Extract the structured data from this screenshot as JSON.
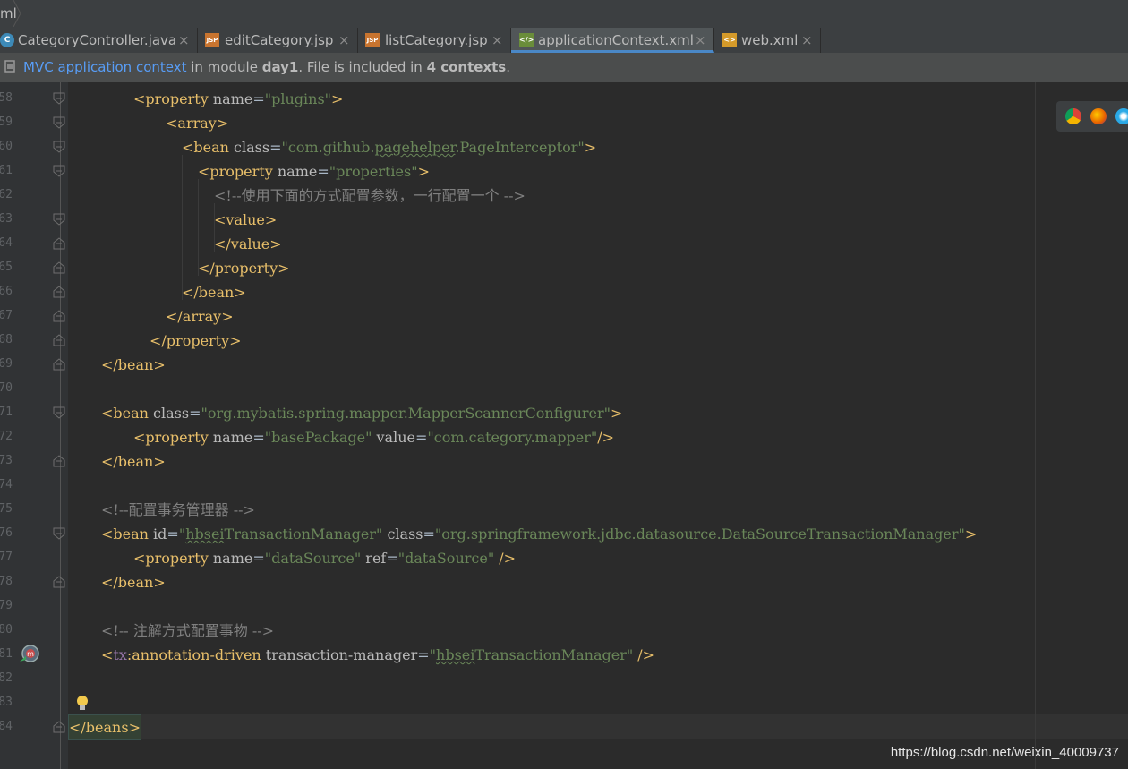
{
  "breadcrumb": {
    "label": "ml"
  },
  "tabs": [
    {
      "label": "CategoryController.java",
      "icon": "java-class-icon",
      "active": false
    },
    {
      "label": "editCategory.jsp",
      "icon": "jsp-file-icon",
      "active": false
    },
    {
      "label": "listCategory.jsp",
      "icon": "jsp-file-icon",
      "active": false
    },
    {
      "label": "applicationContext.xml",
      "icon": "spring-xml-icon",
      "active": true
    },
    {
      "label": "web.xml",
      "icon": "web-xml-icon",
      "active": false
    }
  ],
  "tab_close_glyph": "×",
  "banner": {
    "link": "MVC application context",
    "text_a": " in module ",
    "module": "day1",
    "text_b": ". File is included in ",
    "contexts": "4 contexts",
    "text_c": "."
  },
  "line_numbers": [
    "58",
    "59",
    "60",
    "61",
    "62",
    "63",
    "64",
    "65",
    "66",
    "67",
    "68",
    "69",
    "70",
    "71",
    "72",
    "73",
    "74",
    "75",
    "76",
    "77",
    "78",
    "79",
    "80",
    "81",
    "82",
    "83",
    "84"
  ],
  "code": {
    "l58": {
      "open": "<",
      "tag": "property",
      "attr": " name",
      "eq": "=",
      "val": "\"plugins\"",
      "close": ">"
    },
    "l59": {
      "text": "<array>"
    },
    "l60": {
      "open": "<",
      "tag": "bean",
      "attr": " class",
      "eq": "=",
      "val_a": "\"com.github.",
      "val_sq": "pagehelper",
      "val_b": ".PageInterceptor\"",
      "close": ">"
    },
    "l61": {
      "open": "<",
      "tag": "property",
      "attr": " name",
      "eq": "=",
      "val": "\"properties\"",
      "close": ">"
    },
    "l62": {
      "comment": "<!--使用下面的方式配置参数，一行配置一个 -->"
    },
    "l63": {
      "text": "<value>"
    },
    "l64": {
      "text": "</value>"
    },
    "l65": {
      "text": "</property>"
    },
    "l66": {
      "text": "</bean>"
    },
    "l67": {
      "text": "</array>"
    },
    "l68": {
      "text": "</property>"
    },
    "l69": {
      "text": "</bean>"
    },
    "l71": {
      "open": "<",
      "tag": "bean",
      "attr": " class",
      "eq": "=",
      "val": "\"org.mybatis.spring.mapper.MapperScannerConfigurer\"",
      "close": ">"
    },
    "l72": {
      "open": "<",
      "tag": "property",
      "attr1": " name",
      "val1": "\"basePackage\"",
      "attr2": " value",
      "val2": "\"com.category.mapper\"",
      "close": "/>",
      "eq": "="
    },
    "l73": {
      "text": "</bean>"
    },
    "l75": {
      "comment": "<!--配置事务管理器 -->"
    },
    "l76": {
      "open": "<",
      "tag": "bean",
      "attr1": " id",
      "val1_q": "\"",
      "val1_sq": "hbsei",
      "val1_b": "TransactionManager\"",
      "attr2": " class",
      "val2": "\"org.springframework.jdbc.datasource.DataSourceTransactionManager\"",
      "close": ">",
      "eq": "="
    },
    "l77": {
      "open": "<",
      "tag": "property",
      "attr1": " name",
      "val1": "\"dataSource\"",
      "attr2": " ref",
      "val2": "\"dataSource\"",
      "close": " />",
      "eq": "="
    },
    "l78": {
      "text": "</bean>"
    },
    "l80": {
      "comment": "<!-- 注解方式配置事物 -->"
    },
    "l81": {
      "open": "<",
      "ns": "tx",
      "colon": ":",
      "tag": "annotation-driven",
      "attr": " transaction-manager",
      "eq": "=",
      "val_q": "\"",
      "val_sq": "hbsei",
      "val_b": "TransactionManager\"",
      "close": " />"
    },
    "l84": {
      "text": "</beans>"
    }
  },
  "colors": {
    "tag": "#e8bf6a",
    "attr": "#bababa",
    "value": "#6a8759",
    "comment": "#808080",
    "background": "#2b2b2b",
    "gutter": "#313335",
    "link": "#589df6",
    "tab_active_underline": "#4a88c7"
  },
  "toolbar_icons": [
    "chrome-icon",
    "firefox-icon",
    "safari-icon"
  ],
  "watermark": "https://blog.csdn.net/weixin_40009737"
}
